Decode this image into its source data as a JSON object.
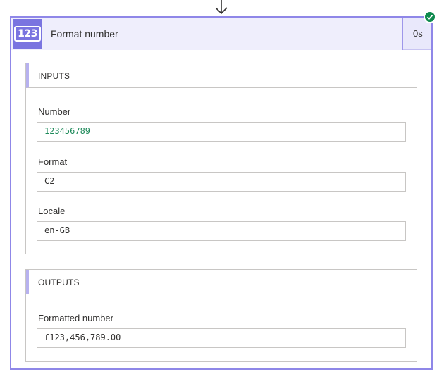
{
  "action": {
    "icon_label": "123",
    "title": "Format number",
    "duration": "0s",
    "status": "succeeded",
    "colors": {
      "accent": "#7a74e0",
      "border": "#8f87e8",
      "success": "#0f8a4e"
    }
  },
  "inputs": {
    "header": "INPUTS",
    "fields": [
      {
        "label": "Number",
        "value": "123456789"
      },
      {
        "label": "Format",
        "value": "C2"
      },
      {
        "label": "Locale",
        "value": "en-GB"
      }
    ]
  },
  "outputs": {
    "header": "OUTPUTS",
    "fields": [
      {
        "label": "Formatted number",
        "value": "£123,456,789.00"
      }
    ]
  },
  "icons": [
    "arrow-down-icon",
    "number-icon",
    "checkmark-icon"
  ]
}
